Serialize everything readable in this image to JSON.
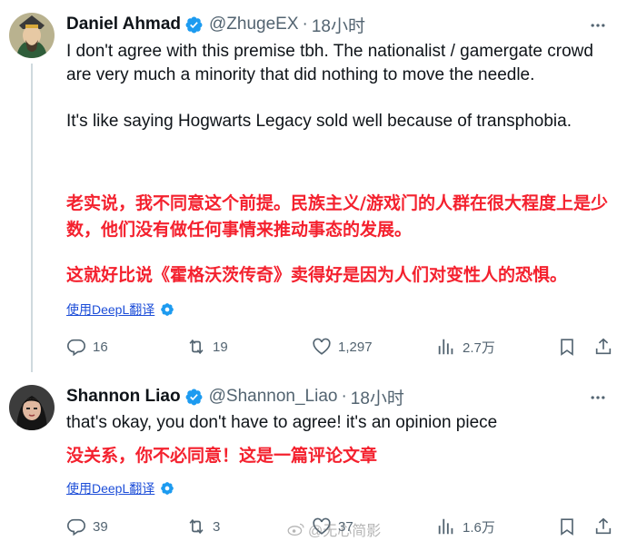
{
  "tweets": [
    {
      "author": "Daniel Ahmad",
      "handle": "@ZhugeEX",
      "separator": "·",
      "time": "18小时",
      "text_lines": [
        "I don't agree with this premise tbh. The nationalist / gamergate crowd are very much a minority that did nothing to move the needle.",
        "It's like saying Hogwarts Legacy sold well because of transphobia."
      ],
      "translation_lines": [
        "老实说，我不同意这个前提。民族主义/游戏门的人群在很大程度上是少数，他们没有做任何事情来推动事态的发展。",
        "这就好比说《霍格沃茨传奇》卖得好是因为人们对变性人的恐惧。"
      ],
      "translate_link": "使用DeepL翻译",
      "stats": {
        "replies": "16",
        "retweets": "19",
        "likes": "1,297",
        "views": "2.7万"
      }
    },
    {
      "author": "Shannon Liao",
      "handle": "@Shannon_Liao",
      "separator": "·",
      "time": "18小时",
      "text_lines": [
        "that's okay, you don't have to agree! it's an opinion piece"
      ],
      "translation_lines": [
        "没关系，你不必同意！这是一篇评论文章"
      ],
      "translate_link": "使用DeepL翻译",
      "stats": {
        "replies": "39",
        "retweets": "3",
        "likes": "37",
        "views": "1.6万"
      }
    }
  ],
  "icons": {
    "verified": "verified-badge-icon",
    "more": "more-icon",
    "reply": "reply-icon",
    "retweet": "retweet-icon",
    "like": "like-icon",
    "views": "views-icon",
    "bookmark": "bookmark-icon",
    "share": "share-icon"
  },
  "colors": {
    "verified": "#1d9bf0",
    "translation": "#f4212e",
    "link": "#1d4ed8",
    "muted": "#536471"
  },
  "watermark": "@无心简影"
}
